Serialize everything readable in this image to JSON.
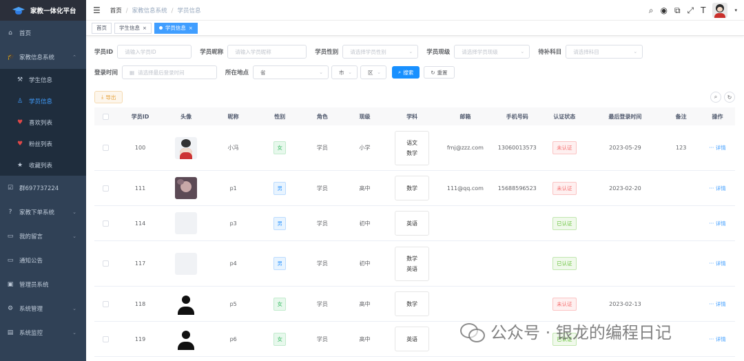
{
  "app": {
    "title": "家教一体化平台"
  },
  "sidebar": {
    "items": [
      {
        "label": "首页",
        "icon": "home-icon",
        "glyph": "⌂"
      },
      {
        "label": "家教信息系统",
        "icon": "graduation-cap-icon",
        "glyph": "🎓",
        "expanded": true
      },
      {
        "label": "群697737224",
        "icon": "checkbox-icon",
        "glyph": "☑"
      },
      {
        "label": "家教下单系统",
        "icon": "question-icon",
        "glyph": "?",
        "arrow": "⌄"
      },
      {
        "label": "我的留言",
        "icon": "message-icon",
        "glyph": "▭",
        "arrow": "⌄"
      },
      {
        "label": "通知公告",
        "icon": "notice-icon",
        "glyph": "▭"
      },
      {
        "label": "管理员系统",
        "icon": "admin-icon",
        "glyph": "▣"
      },
      {
        "label": "系统管理",
        "icon": "settings-icon",
        "glyph": "⚙",
        "arrow": "⌄"
      },
      {
        "label": "系统监控",
        "icon": "monitor-icon",
        "glyph": "▤",
        "arrow": "⌄"
      }
    ],
    "subitems": [
      {
        "label": "学生信息",
        "icon": "student-icon",
        "glyph": "⚒"
      },
      {
        "label": "学员信息",
        "icon": "user-icon",
        "glyph": "♙",
        "active": true
      },
      {
        "label": "喜欢列表",
        "icon": "heart-icon",
        "glyph": "♥"
      },
      {
        "label": "粉丝列表",
        "icon": "fans-icon",
        "glyph": "♥"
      },
      {
        "label": "收藏列表",
        "icon": "star-icon",
        "glyph": "★"
      }
    ],
    "collapse_arrow": "⌃"
  },
  "navbar": {
    "breadcrumb": [
      "首页",
      "家教信息系统",
      "学员信息"
    ],
    "separator": "/",
    "icons": [
      "search-icon",
      "github-icon",
      "external-link-icon",
      "fullscreen-icon",
      "font-size-icon"
    ]
  },
  "tags": [
    {
      "label": "首页"
    },
    {
      "label": "学生信息",
      "close": "×"
    },
    {
      "label": "学员信息",
      "close": "×",
      "active": true
    }
  ],
  "search": {
    "id_label": "学员ID",
    "id_placeholder": "请输入学员ID",
    "nick_label": "学员昵称",
    "nick_placeholder": "请输入学员昵称",
    "sex_label": "学员性别",
    "sex_placeholder": "请选择学员性别",
    "grade_label": "学员现级",
    "grade_placeholder": "请选择学员现级",
    "subject_label": "待补科目",
    "subject_placeholder": "请选择科目",
    "login_label": "登录时间",
    "login_placeholder": "请选择最后登录时间",
    "location_label": "所在地点",
    "province": "省",
    "city": "市",
    "district": "区",
    "search_btn": "搜索",
    "reset_btn": "重置"
  },
  "toolbar": {
    "export": "导出"
  },
  "table": {
    "headers": [
      "学员ID",
      "头像",
      "昵称",
      "性别",
      "角色",
      "现级",
      "学科",
      "邮箱",
      "手机号码",
      "认证状态",
      "最后登录时间",
      "备注",
      "操作"
    ],
    "detail_label": "详情",
    "rows": [
      {
        "id": "100",
        "avatar": "a0",
        "nick": "小冯",
        "sex": "女",
        "sex_cls": "f",
        "role": "学员",
        "grade": "小学",
        "subjects": [
          "语文",
          "数学"
        ],
        "email": "fmj@zzz.com",
        "phone": "13060013573",
        "status": "未认证",
        "status_cls": "no",
        "last_login": "2023-05-29",
        "remark": "123",
        "h": 66
      },
      {
        "id": "111",
        "avatar": "a1",
        "nick": "p1",
        "sex": "男",
        "sex_cls": "m",
        "role": "学员",
        "grade": "高中",
        "subjects": [
          "数学"
        ],
        "email": "111@qq.com",
        "phone": "15688596523",
        "status": "未认证",
        "status_cls": "no",
        "last_login": "2023-02-20",
        "remark": "",
        "h": 51
      },
      {
        "id": "114",
        "avatar": "",
        "nick": "p3",
        "sex": "男",
        "sex_cls": "m",
        "role": "学员",
        "grade": "初中",
        "subjects": [
          "英语"
        ],
        "email": "",
        "phone": "",
        "status": "已认证",
        "status_cls": "yes",
        "last_login": "",
        "remark": "",
        "h": 51
      },
      {
        "id": "117",
        "avatar": "",
        "nick": "p4",
        "sex": "男",
        "sex_cls": "m",
        "role": "学员",
        "grade": "初中",
        "subjects": [
          "数学",
          "英语"
        ],
        "email": "",
        "phone": "",
        "status": "已认证",
        "status_cls": "yes",
        "last_login": "",
        "remark": "",
        "h": 66
      },
      {
        "id": "118",
        "avatar": "a2",
        "nick": "p5",
        "sex": "女",
        "sex_cls": "f",
        "role": "学员",
        "grade": "高中",
        "subjects": [
          "数学"
        ],
        "email": "",
        "phone": "",
        "status": "未认证",
        "status_cls": "no",
        "last_login": "2023-02-13",
        "remark": "",
        "h": 51
      },
      {
        "id": "119",
        "avatar": "a2",
        "nick": "p6",
        "sex": "女",
        "sex_cls": "f",
        "role": "学员",
        "grade": "高中",
        "subjects": [
          "英语"
        ],
        "email": "",
        "phone": "",
        "status": "已认证",
        "status_cls": "yes",
        "last_login": "",
        "remark": "",
        "h": 51
      }
    ]
  },
  "watermark": {
    "text": "公众号 · 银龙的编程日记"
  },
  "colors": {
    "sidebar_bg": "#304156",
    "primary": "#1890ff",
    "active_menu": "#409eff"
  }
}
